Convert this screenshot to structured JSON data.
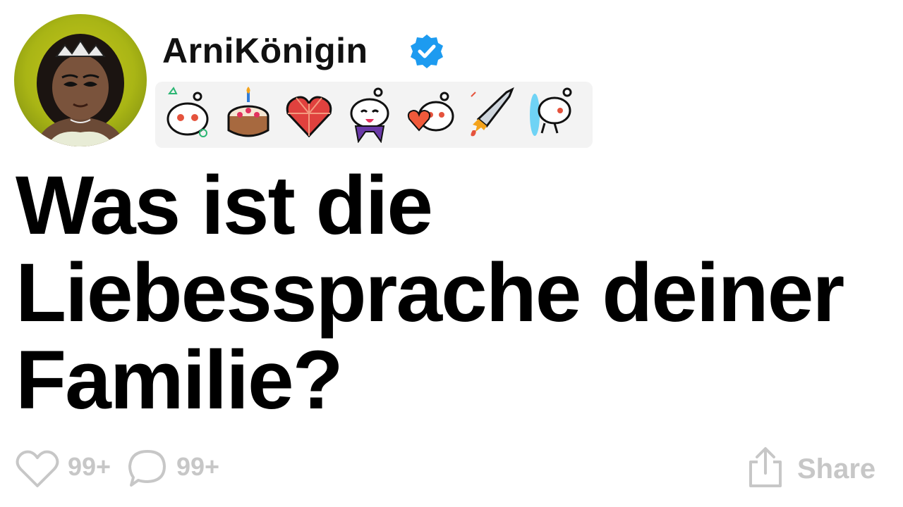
{
  "user": {
    "name": "ArniKönigin",
    "verified_icon": "verified-check-icon",
    "avatar": "princess-avatar"
  },
  "awards": [
    {
      "name": "helpful-snoo-award-icon"
    },
    {
      "name": "birthday-cake-award-icon"
    },
    {
      "name": "heart-gem-award-icon"
    },
    {
      "name": "wholesome-snoo-award-icon"
    },
    {
      "name": "heart-snoo-award-icon"
    },
    {
      "name": "rocket-award-icon"
    },
    {
      "name": "portal-snoo-award-icon"
    }
  ],
  "post": {
    "title": "Was ist die Liebessprache deiner Familie?"
  },
  "footer": {
    "like_count": "99+",
    "comment_count": "99+",
    "share_label": "Share"
  },
  "colors": {
    "verified": "#1d9bf0",
    "muted": "#c7c7c7",
    "awards_bg": "#f3f3f3"
  }
}
